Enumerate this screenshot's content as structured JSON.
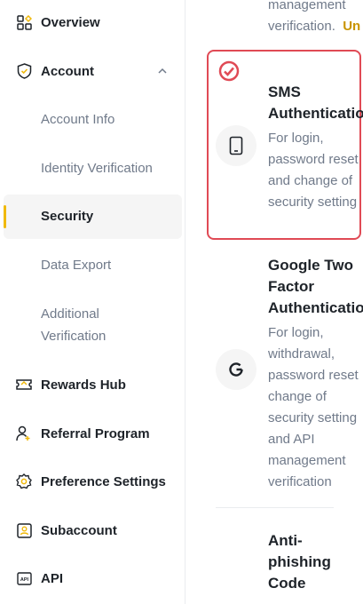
{
  "sidebar": {
    "items": [
      {
        "label": "Overview",
        "icon": "grid-icon"
      },
      {
        "label": "Account",
        "icon": "shield-icon"
      },
      {
        "label": "Rewards Hub",
        "icon": "ticket-icon"
      },
      {
        "label": "Referral Program",
        "icon": "user-plus-icon"
      },
      {
        "label": "Preference Settings",
        "icon": "gear-icon"
      },
      {
        "label": "Subaccount",
        "icon": "user-card-icon"
      },
      {
        "label": "API",
        "icon": "api-icon"
      }
    ],
    "account_sub": [
      {
        "label": "Account Info"
      },
      {
        "label": "Identity Verification"
      },
      {
        "label": "Security"
      },
      {
        "label": "Data Export"
      },
      {
        "label": "Additional Verification",
        "line1": "Additional",
        "line2": "Verification"
      }
    ],
    "active": "Security",
    "accent_color": "#f0b90b"
  },
  "main": {
    "top": {
      "line1": "management",
      "line2": "verification.",
      "link": "Un"
    },
    "sms": {
      "title1": "SMS",
      "title2": "Authenticatio",
      "desc": [
        "For login,",
        "password reset",
        "and change of",
        "security setting"
      ],
      "icon": "phone-icon"
    },
    "google": {
      "title": [
        "Google Two",
        "Factor",
        "Authenticatio"
      ],
      "desc": [
        "For login,",
        "withdrawal,",
        "password reset",
        "change of",
        "security setting",
        "and API",
        "management",
        "verification"
      ],
      "icon": "google-icon"
    },
    "anti": {
      "title": [
        "Anti-",
        "phishing",
        "Code"
      ]
    },
    "highlight_color": "#e04a55"
  }
}
